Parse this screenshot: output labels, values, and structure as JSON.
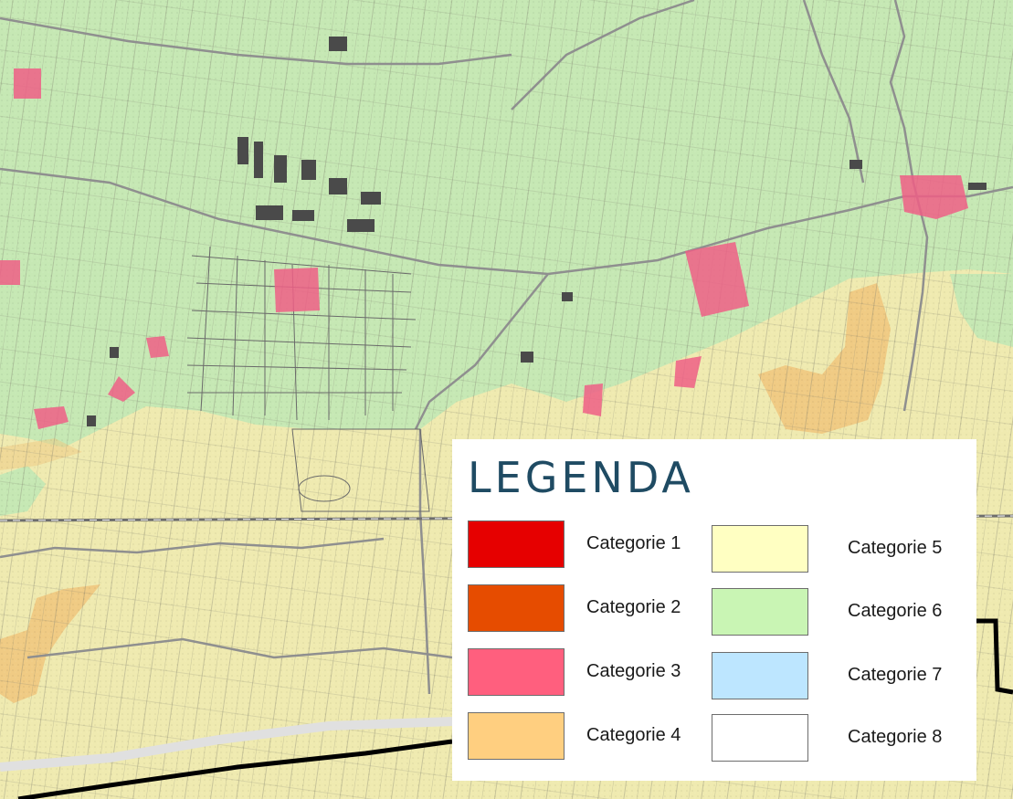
{
  "legend": {
    "title": "LEGENDA",
    "categories": [
      {
        "label": "Categorie 1",
        "color": "#e60000"
      },
      {
        "label": "Categorie 2",
        "color": "#e64c00"
      },
      {
        "label": "Categorie 3",
        "color": "#ff5f7e"
      },
      {
        "label": "Categorie 4",
        "color": "#ffcf80"
      },
      {
        "label": "Categorie 5",
        "color": "#ffffc2"
      },
      {
        "label": "Categorie 6",
        "color": "#c9f5b4"
      },
      {
        "label": "Categorie 7",
        "color": "#bde6ff"
      },
      {
        "label": "Categorie 8",
        "color": "#ffffff"
      }
    ]
  },
  "map_colors": {
    "category_5_fill": "#efeab0",
    "category_6_fill": "#c6e8b4",
    "category_4_fill": "#f0c87f",
    "category_3_fill": "#ee5f86",
    "road": "#9a9a9a",
    "building": "#4a4a4a",
    "boundary_line": "#000000"
  }
}
